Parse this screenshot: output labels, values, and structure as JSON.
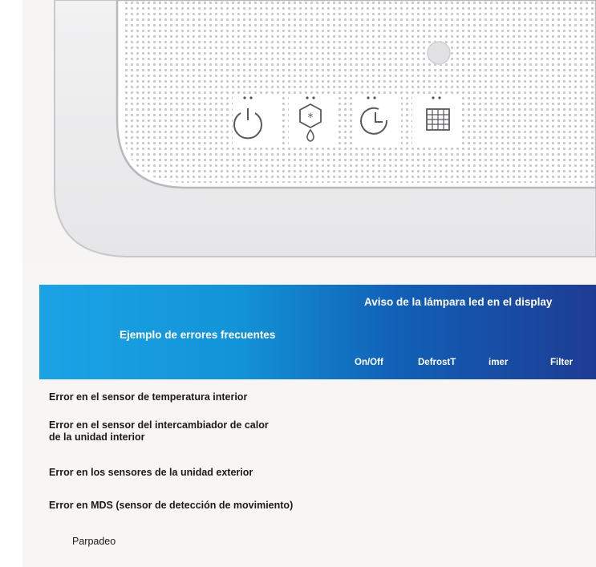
{
  "device": {
    "icons": [
      {
        "name": "power-icon"
      },
      {
        "name": "defrost-icon"
      },
      {
        "name": "timer-icon"
      },
      {
        "name": "filter-icon"
      }
    ]
  },
  "table": {
    "group_header": "Aviso de la lámpara led en el display",
    "row_header": "Ejemplo de errores frecuentes",
    "columns": [
      "On/Off",
      "DefrostT",
      "imer",
      "Filter"
    ],
    "rows": [
      {
        "label_lines": [
          "Error en el sensor de temperatura interior"
        ]
      },
      {
        "label_lines": [
          "Error en el sensor del intercambiador de calor",
          "de la unidad interior"
        ]
      },
      {
        "label_lines": [
          "Error en los sensores de la unidad exterior"
        ]
      },
      {
        "label_lines": [
          "Error en MDS (sensor de detección de movimiento)"
        ]
      }
    ]
  },
  "legend": {
    "blink_label": "Parpadeo"
  },
  "colors": {
    "header_gradient_start": "#1aa3e6",
    "header_gradient_end": "#1f3c94",
    "text": "#1a1a1a"
  }
}
